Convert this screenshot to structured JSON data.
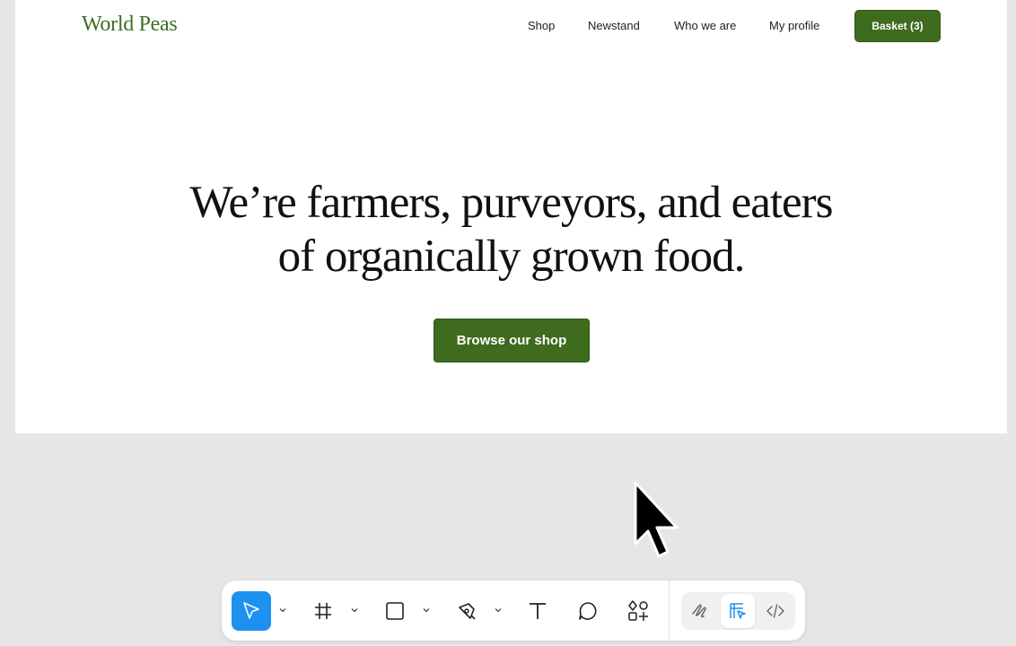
{
  "site": {
    "logo": "World Peas",
    "nav": [
      {
        "label": "Shop"
      },
      {
        "label": "Newstand"
      },
      {
        "label": "Who we are"
      },
      {
        "label": "My profile"
      }
    ],
    "basket_label": "Basket (3)",
    "headline_line1": "We’re farmers, purveyors, and eaters",
    "headline_line2": "of organically grown food.",
    "cta_label": "Browse our shop",
    "brand_color": "#3e6b1e"
  },
  "toolbar": {
    "tools": [
      {
        "icon": "move-pointer-icon",
        "active": true
      },
      {
        "icon": "frame-icon"
      },
      {
        "icon": "rectangle-icon"
      },
      {
        "icon": "pen-icon"
      },
      {
        "icon": "text-icon"
      },
      {
        "icon": "comment-icon"
      },
      {
        "icon": "components-icon"
      }
    ],
    "modes": [
      {
        "icon": "draw-mode-icon"
      },
      {
        "icon": "design-mode-icon",
        "active": true
      },
      {
        "icon": "dev-mode-icon"
      }
    ],
    "accent_color": "#1e90f0"
  }
}
